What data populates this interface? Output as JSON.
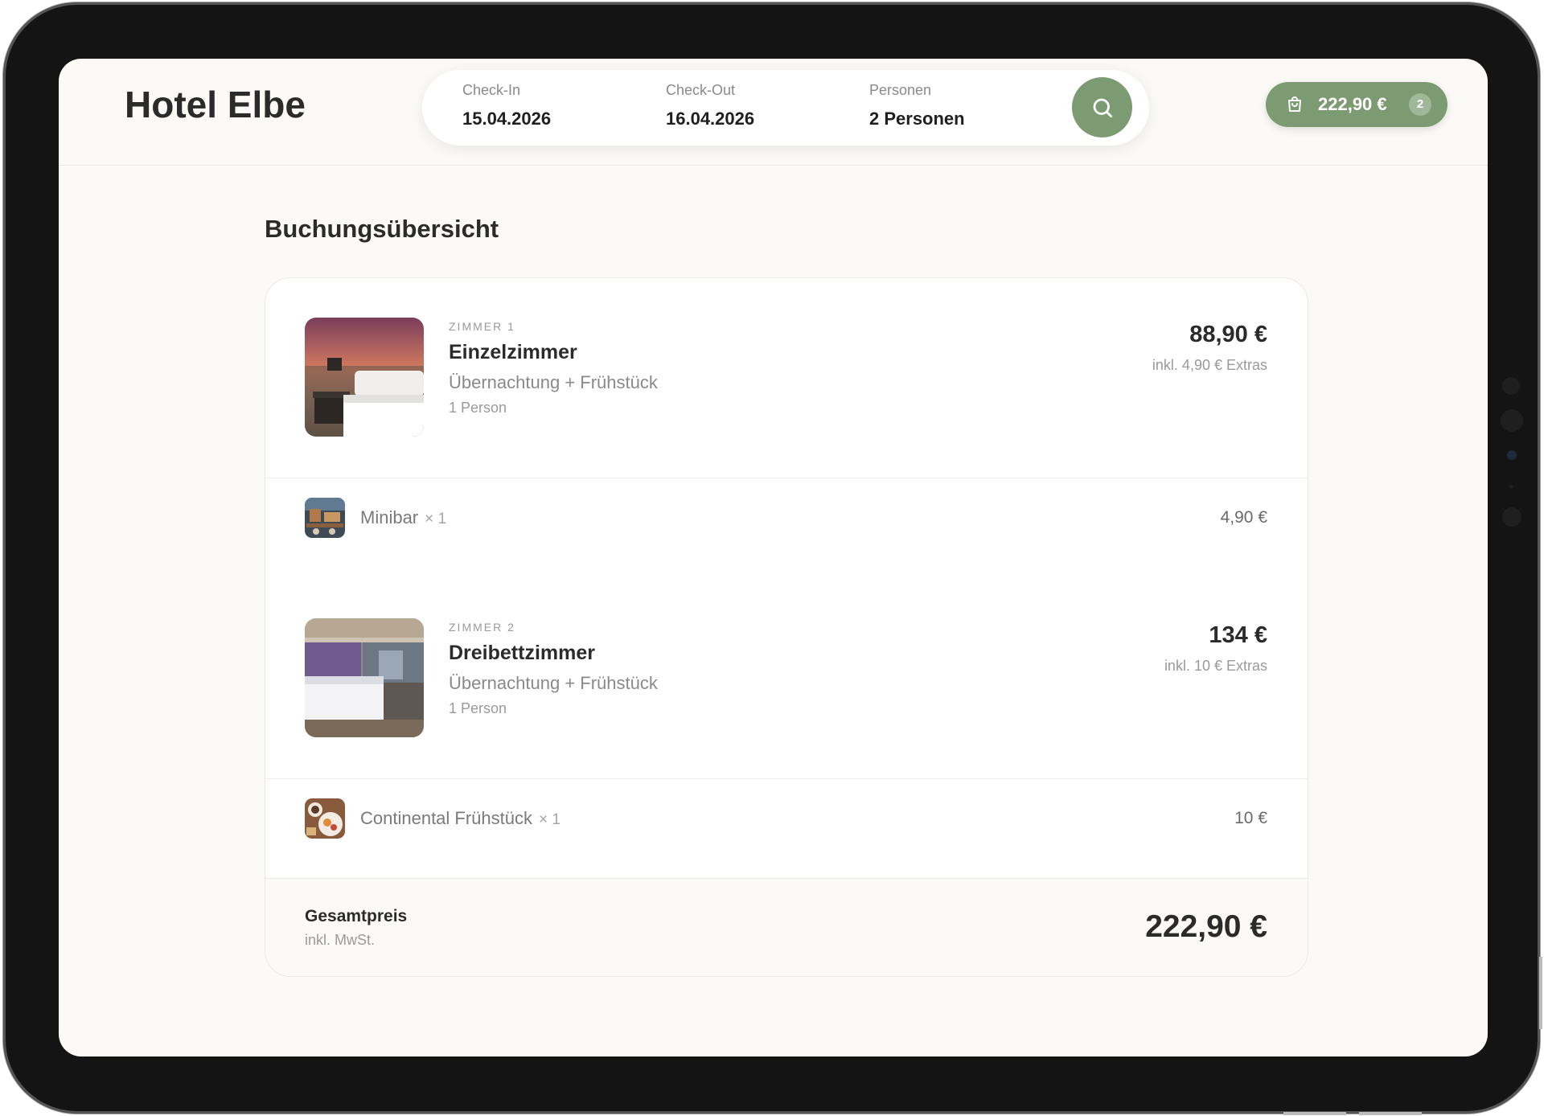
{
  "brand": "Hotel Elbe",
  "search": {
    "checkin_label": "Check-In",
    "checkin_value": "15.04.2026",
    "checkout_label": "Check-Out",
    "checkout_value": "16.04.2026",
    "persons_label": "Personen",
    "persons_value": "2 Personen",
    "button_icon": "search-icon"
  },
  "cart": {
    "icon": "shopping-bag-icon",
    "amount": "222,90 €",
    "count": "2"
  },
  "page_title": "Buchungsübersicht",
  "rooms": [
    {
      "tag": "ZIMMER 1",
      "name": "Einzelzimmer",
      "description": "Übernachtung + Frühstück",
      "persons": "1 Person",
      "price": "88,90 €",
      "extras_note": "inkl. 4,90 € Extras",
      "extra": {
        "name": "Minibar",
        "qty": "× 1",
        "price": "4,90 €"
      }
    },
    {
      "tag": "ZIMMER 2",
      "name": "Dreibettzimmer",
      "description": "Übernachtung + Frühstück",
      "persons": "1 Person",
      "price": "134 €",
      "extras_note": "inkl. 10 € Extras",
      "extra": {
        "name": "Continental Frühstück",
        "qty": "× 1",
        "price": "10 €"
      }
    }
  ],
  "total": {
    "label": "Gesamtpreis",
    "sublabel": "inkl. MwSt.",
    "value": "222,90 €"
  },
  "colors": {
    "accent": "#7d9b72",
    "background": "#fbfaf7",
    "text": "#2b2b2b"
  }
}
